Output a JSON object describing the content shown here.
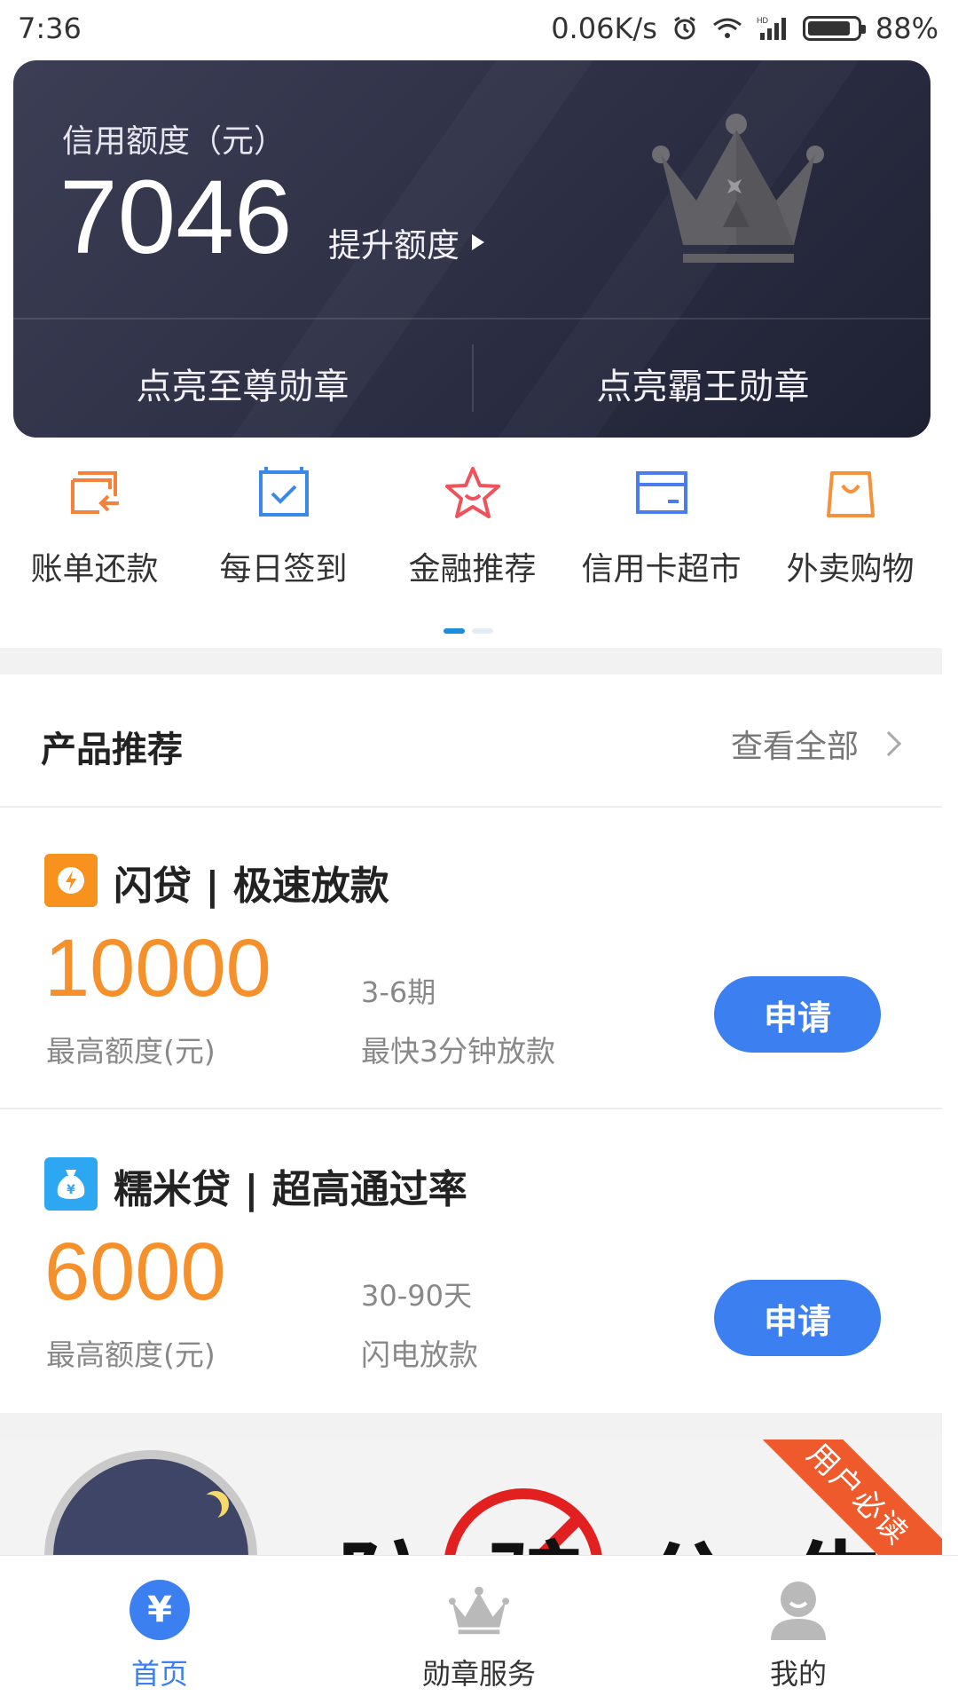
{
  "status_bar": {
    "time": "7:36",
    "net_speed": "0.06K/s",
    "battery": "88%",
    "battery_level": 0.88,
    "icons": [
      "alarm-icon",
      "wifi-icon",
      "signal-icon",
      "battery-icon"
    ]
  },
  "credit_card": {
    "label": "信用额度（元）",
    "amount": "7046",
    "raise_label": "提升额度",
    "left_badge": "点亮至尊勋章",
    "right_badge": "点亮霸王勋章",
    "icon": "crown-icon"
  },
  "quick_menu": {
    "items": [
      {
        "label": "账单还款",
        "icon": "bill-repay-icon",
        "color": "#f5813b"
      },
      {
        "label": "每日签到",
        "icon": "checkin-icon",
        "color": "#3a88e8"
      },
      {
        "label": "金融推荐",
        "icon": "star-icon",
        "color": "#f0525c"
      },
      {
        "label": "信用卡超市",
        "icon": "card-icon",
        "color": "#4a7cf0"
      },
      {
        "label": "外卖购物",
        "icon": "bag-icon",
        "color": "#f5913a"
      }
    ],
    "pages": 2,
    "active_page": 1
  },
  "products": {
    "title": "产品推荐",
    "see_all": "查看全部",
    "items": [
      {
        "name": "闪贷 | 极速放款",
        "logo_icon": "lightning-icon",
        "logo_color": "#f7921e",
        "amount": "10000",
        "amount_label": "最高额度(元)",
        "term": "3-6期",
        "speed": "最快3分钟放款",
        "apply_label": "申请"
      },
      {
        "name": "糯米贷 | 超高通过率",
        "logo_icon": "money-bag-icon",
        "logo_color": "#2ea7f2",
        "amount": "6000",
        "amount_label": "最高额度(元)",
        "term": "30-90天",
        "speed": "闪电放款",
        "apply_label": "申请"
      }
    ]
  },
  "notice": {
    "title": "防骗公告",
    "ribbon": "用户必读"
  },
  "bottom_nav": {
    "items": [
      {
        "label": "首页",
        "icon": "yen-icon",
        "active": true
      },
      {
        "label": "勋章服务",
        "icon": "crown-icon",
        "active": false
      },
      {
        "label": "我的",
        "icon": "user-icon",
        "active": false
      }
    ]
  },
  "colors": {
    "accent_blue": "#3b7ff0",
    "amount_orange": "#f5902a",
    "card_dark": "#2f3147"
  }
}
